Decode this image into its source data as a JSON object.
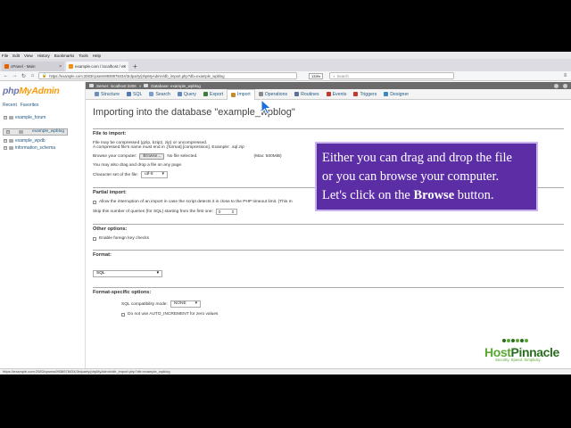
{
  "browser": {
    "menu": [
      "File",
      "Edit",
      "View",
      "History",
      "Bookmarks",
      "Tools",
      "Help"
    ],
    "tabs": [
      {
        "label": "cPanel - Main",
        "active": false
      },
      {
        "label": "example.com / localhost / ex",
        "active": true
      }
    ],
    "url": "https://example.com:2083/cpsess9938978434/3rdparty/phpMyAdmin/db_import.php?db=example_wpblog",
    "zoom": "133%",
    "search_placeholder": "Search",
    "status_url": "https://example.com:2083/cpsess9938978434/3rdparty/phpMyAdmin/db_import.php?db=example_wpblog"
  },
  "sidebar": {
    "logo_a": "php",
    "logo_b": "MyAdmin",
    "links": [
      "Recent",
      "Favorites"
    ],
    "databases": [
      {
        "name": "example_forum",
        "selected": false
      },
      {
        "name": "example_wpblog",
        "selected": true
      },
      {
        "name": "example_wpdb",
        "selected": false
      },
      {
        "name": "information_schema",
        "selected": false
      }
    ]
  },
  "breadcrumb": {
    "server": "Server: localhost:3306",
    "database": "Database: example_wpblog"
  },
  "tabs": [
    {
      "label": "Structure",
      "color": "#6a8fbf"
    },
    {
      "label": "SQL",
      "color": "#4f7ab3"
    },
    {
      "label": "Search",
      "color": "#7aa0c9"
    },
    {
      "label": "Query",
      "color": "#5f87b8"
    },
    {
      "label": "Export",
      "color": "#3d7a3d"
    },
    {
      "label": "Import",
      "color": "#c88a2a",
      "active": true
    },
    {
      "label": "Operations",
      "color": "#8a8a8a"
    },
    {
      "label": "Routines",
      "color": "#5a6f9a"
    },
    {
      "label": "Events",
      "color": "#c0392b"
    },
    {
      "label": "Triggers",
      "color": "#c0392b"
    },
    {
      "label": "Designer",
      "color": "#3a8abf"
    }
  ],
  "main": {
    "title": "Importing into the database \"example_wpblog\"",
    "file_section": {
      "heading": "File to import:",
      "compress_1": "File may be compressed (gzip, bzip2, zip) or uncompressed.",
      "compress_2": "A compressed file's name must end in .[format].[compression]. Example: .sql.zip",
      "browse_label": "Browse your computer:",
      "browse_button": "Browse...",
      "no_file": "No file selected.",
      "max": "(Max: 500MiB)",
      "drag_note": "You may also drag and drop a file on any page.",
      "charset_label": "Character set of the file:",
      "charset_value": "utf-8"
    },
    "partial_section": {
      "heading": "Partial import:",
      "allow_text": "Allow the interruption of an import in case the script detects it is close to the PHP timeout limit. (This m",
      "skip_label": "Skip this number of queries (for SQL) starting from the first one:",
      "skip_value": "0"
    },
    "other_section": {
      "heading": "Other options:",
      "fk_label": "Enable foreign key checks"
    },
    "format_section": {
      "heading": "Format:",
      "value": "SQL"
    },
    "specific_section": {
      "heading": "Format-specific options:",
      "compat_label": "SQL compatibility mode:",
      "compat_value": "NONE",
      "auto_label": "Do not use AUTO_INCREMENT for zero values"
    }
  },
  "overlay": {
    "line1": "Either you can drag and drop the file",
    "line2": "or you can browse your computer.",
    "line3_pre": "Let's click on the ",
    "line3_bold": "Browse",
    "line3_post": " button."
  },
  "brand": {
    "name_a": "Host",
    "name_b": "Pinnacle",
    "tagline": "Security. Speed. Simplicity."
  }
}
